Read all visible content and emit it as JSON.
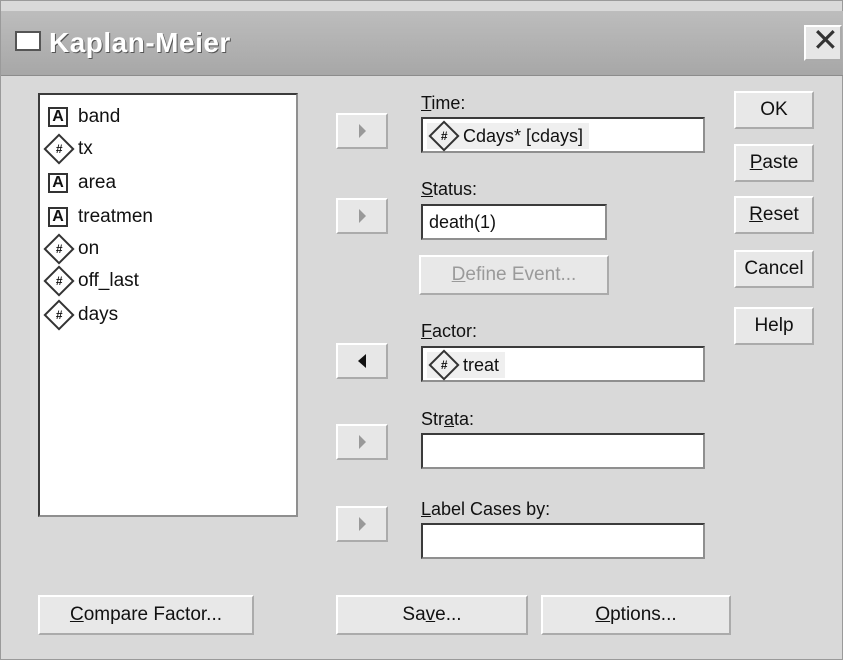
{
  "window": {
    "title": "Kaplan-Meier"
  },
  "source_variables": [
    {
      "name": "band",
      "type_icon": "string-icon"
    },
    {
      "name": "tx",
      "type_icon": "numeric-icon"
    },
    {
      "name": "area",
      "type_icon": "string-icon"
    },
    {
      "name": "treatmen",
      "type_icon": "string-icon"
    },
    {
      "name": "on",
      "type_icon": "numeric-icon"
    },
    {
      "name": "off_last",
      "type_icon": "numeric-icon"
    },
    {
      "name": "days",
      "type_icon": "numeric-icon"
    }
  ],
  "time": {
    "label_rest": "ime:",
    "label_ul": "T",
    "value": "Cdays* [cdays]"
  },
  "status": {
    "label_ul": "S",
    "label_rest": "tatus:",
    "value": "death(1)"
  },
  "define_event": {
    "ul": "D",
    "rest": "efine Event..."
  },
  "factor": {
    "label_ul": "F",
    "label_rest": "actor:",
    "value": "treat"
  },
  "strata": {
    "label_pre": "Str",
    "label_ul": "a",
    "label_rest": "ta:",
    "value": ""
  },
  "label_cases": {
    "label_ul": "L",
    "label_rest": "abel Cases by:",
    "value": ""
  },
  "buttons": {
    "ok": "OK",
    "paste_ul": "P",
    "paste_rest": "aste",
    "reset_ul": "R",
    "reset_rest": "eset",
    "cancel": "Cancel",
    "help": "Help",
    "compare_ul": "C",
    "compare_rest": "ompare Factor...",
    "save_pre": "Sa",
    "save_ul": "v",
    "save_rest": "e...",
    "options_ul": "O",
    "options_rest": "ptions..."
  },
  "colors": {
    "dialog_bg": "#d9d9d9",
    "titlebar": "#a7a7a7",
    "field_bg": "#ffffff"
  }
}
